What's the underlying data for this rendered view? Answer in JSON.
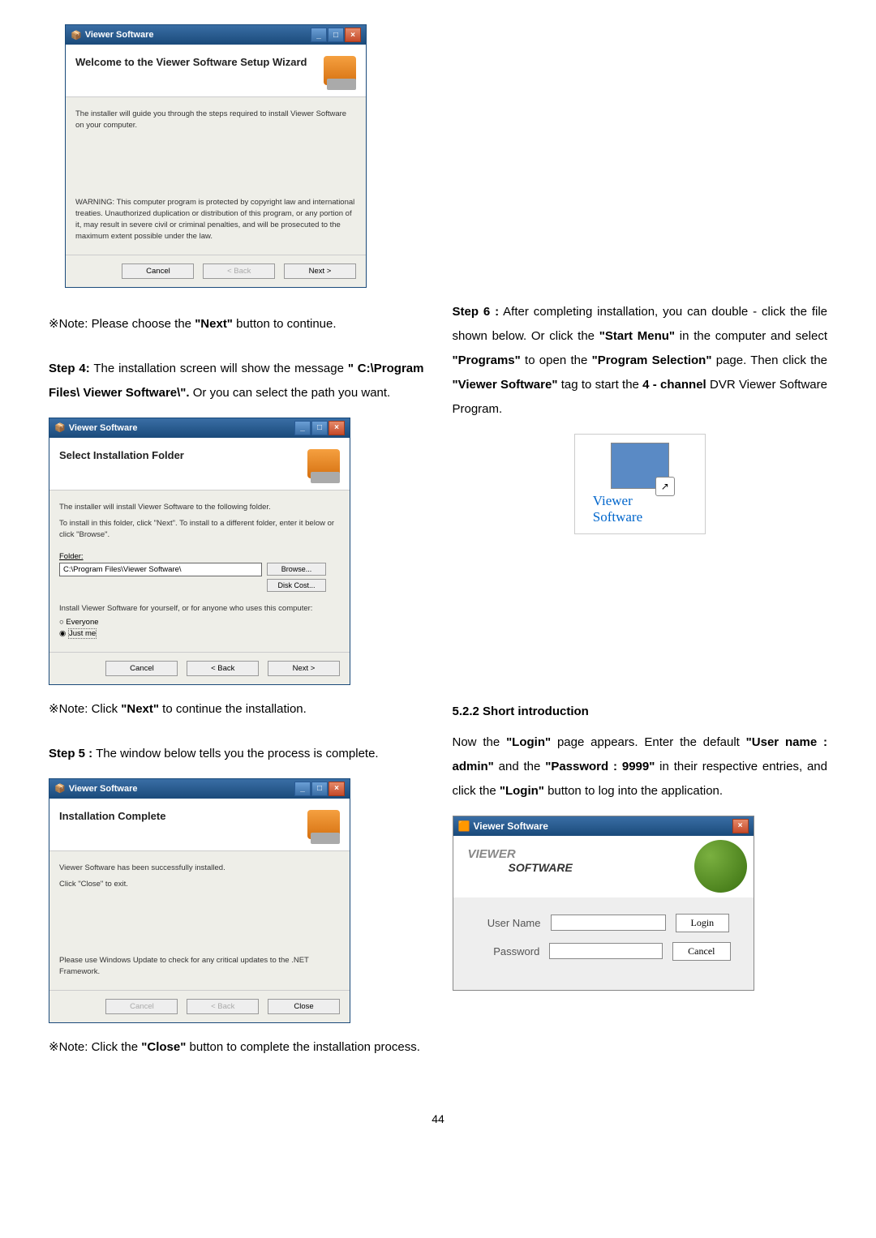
{
  "installer1": {
    "window_title": "Viewer Software",
    "title": "Welcome to the Viewer Software Setup Wizard",
    "text1": "The installer will guide you through the steps required to install Viewer Software on your computer.",
    "warning": "WARNING: This computer program is protected by copyright law and international treaties. Unauthorized duplication or distribution of this program, or any portion of it, may result in severe civil or criminal penalties, and will be prosecuted to the maximum extent possible under the law.",
    "btn_cancel": "Cancel",
    "btn_back": "< Back",
    "btn_next": "Next >"
  },
  "note1": {
    "prefix": "※Note:",
    "text_a": " Please choose the ",
    "bold_a": "\"Next\"",
    "text_b": " button to continue."
  },
  "step4": {
    "bold": "Step 4:",
    "text_a": " The installation screen will show the message ",
    "bold_a": "\" C:\\Program Files\\ Viewer Software\\\".",
    "text_b": " Or you can select the path you want."
  },
  "installer2": {
    "window_title": "Viewer Software",
    "title": "Select Installation Folder",
    "text1": "The installer will install Viewer Software to the following folder.",
    "text2": "To install in this folder, click \"Next\". To install to a different folder, enter it below or click \"Browse\".",
    "folder_label": "Folder:",
    "folder_value": "C:\\Program Files\\Viewer Software\\",
    "btn_browse": "Browse...",
    "btn_disk": "Disk Cost...",
    "scope_text": "Install Viewer Software for yourself, or for anyone who uses this computer:",
    "opt_everyone": "Everyone",
    "opt_justme": "Just me",
    "btn_cancel": "Cancel",
    "btn_back": "< Back",
    "btn_next": "Next >"
  },
  "note2": {
    "prefix": "※Note:",
    "text_a": " Click ",
    "bold_a": "\"Next\"",
    "text_b": " to continue the installation."
  },
  "step5": {
    "bold": "Step 5 :",
    "text": " The window below tells you the process is complete."
  },
  "installer3": {
    "window_title": "Viewer Software",
    "title": "Installation Complete",
    "text1": "Viewer Software has been successfully installed.",
    "text2": "Click \"Close\" to exit.",
    "text3": "Please use Windows Update to check for any critical updates to the .NET Framework.",
    "btn_cancel": "Cancel",
    "btn_back": "< Back",
    "btn_close": "Close"
  },
  "note3": {
    "prefix": "※Note:",
    "text_a": " Click the ",
    "bold_a": "\"Close\"",
    "text_b": " button to complete the installation process."
  },
  "step6": {
    "bold": "Step 6 :",
    "text_a": " After completing installation, you can double - click the file shown below. Or click the ",
    "bold_a": "\"Start Menu\"",
    "text_b": " in the computer and select ",
    "bold_b": "\"Programs\"",
    "text_c": " to open the ",
    "bold_c": "\"Program Selection\"",
    "text_d": " page. Then click the ",
    "bold_d": "\"Viewer Software\"",
    "text_e": " tag to start the ",
    "bold_e": "4 - channel",
    "text_f": " DVR Viewer Software Program."
  },
  "shortcut": {
    "line1": "Viewer",
    "line2": "Software"
  },
  "section": {
    "num": "5.2.2 Short introduction"
  },
  "login_intro": {
    "text_a": "Now the ",
    "bold_a": "\"Login\"",
    "text_b": " page appears. Enter the default ",
    "bold_b": "\"User name : admin\"",
    "text_c": " and the ",
    "bold_c": "\"Password : 9999\"",
    "text_d": " in their respective entries, and click the ",
    "bold_d": "\"Login\"",
    "text_e": " button to log into the application."
  },
  "login": {
    "window_title": "Viewer Software",
    "banner_viewer": "VIEWER",
    "banner_software": "SOFTWARE",
    "label_user": "User Name",
    "label_pass": "Password",
    "btn_login": "Login",
    "btn_cancel": "Cancel"
  },
  "page_num": "44"
}
